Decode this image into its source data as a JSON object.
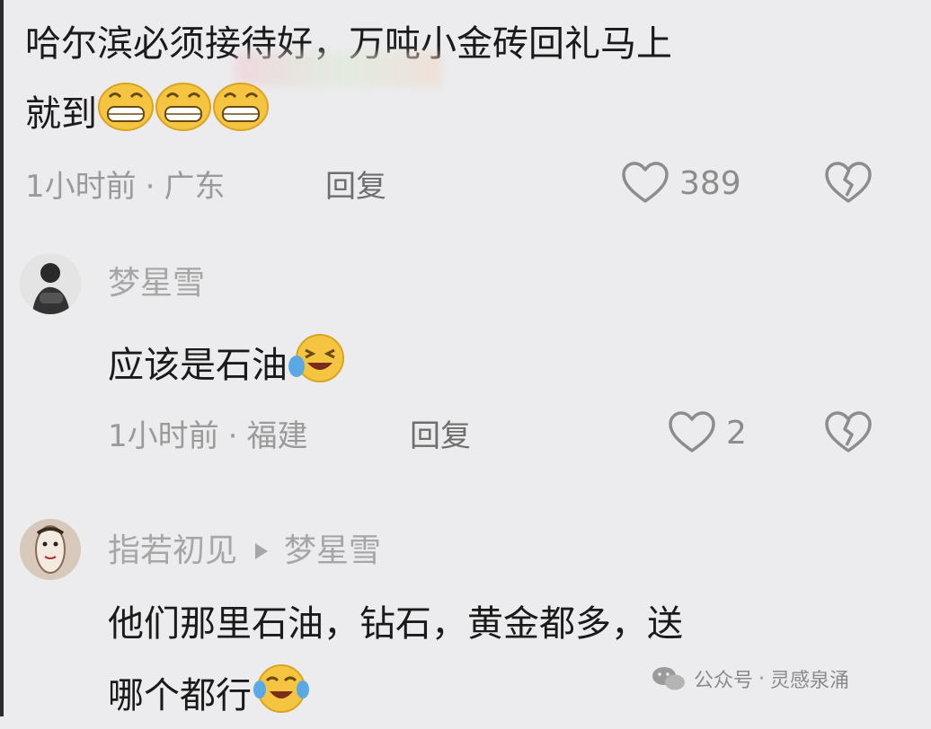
{
  "comments": [
    {
      "text_line1": "哈尔滨必须接待好，万吨小金砖回礼马上",
      "text_line2": "就到",
      "time": "1小时前",
      "location": "广东",
      "reply_label": "回复",
      "likes": "389"
    },
    {
      "username": "梦星雪",
      "text": "应该是石油",
      "time": "1小时前",
      "location": "福建",
      "reply_label": "回复",
      "likes": "2"
    },
    {
      "username": "指若初见",
      "reply_to": "梦星雪",
      "text_line1": "他们那里石油，钻石，黄金都多，送",
      "text_line2": "哪个都行"
    }
  ],
  "meta_separator": "·",
  "watermark": {
    "prefix": "公众号",
    "separator": "·",
    "name": "灵感泉涌"
  }
}
